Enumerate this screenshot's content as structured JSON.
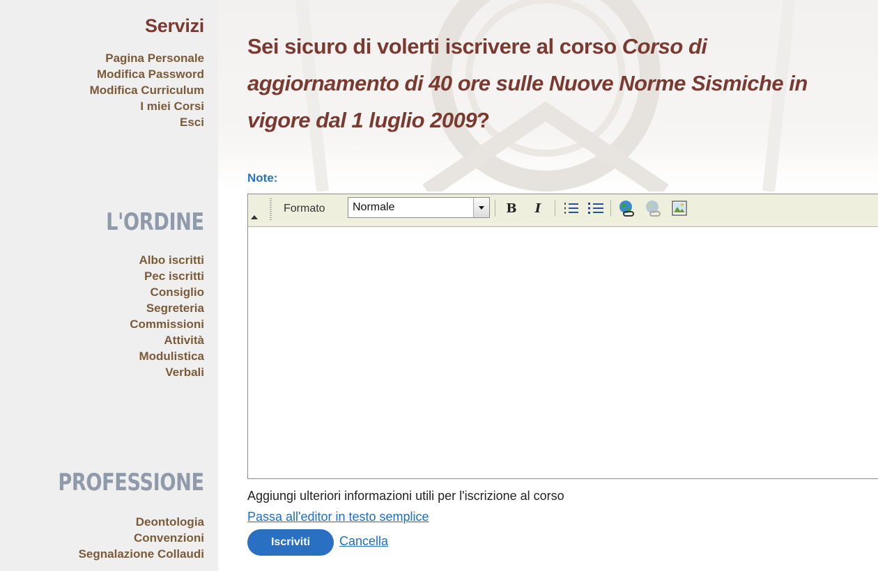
{
  "sidebar": {
    "servizi": {
      "title": "Servizi",
      "items": [
        "Pagina Personale",
        "Modifica Password",
        "Modifica Curriculum",
        "I miei Corsi",
        "Esci"
      ]
    },
    "ordine": {
      "title": "L'ORDINE",
      "items": [
        "Albo iscritti",
        "Pec iscritti",
        "Consiglio",
        "Segreteria",
        "Commissioni",
        "Attività",
        "Modulistica",
        "Verbali"
      ]
    },
    "professione": {
      "title": "PROFESSIONE",
      "items": [
        "Deontologia",
        "Convenzioni",
        "Segnalazione Collaudi"
      ]
    }
  },
  "main": {
    "title_prefix": "Sei sicuro di volerti iscrivere al corso ",
    "course_name": "Corso di aggiornamento di 40 ore sulle Nuove Norme Sismiche in vigore dal 1 luglio 2009",
    "title_suffix": "?",
    "note_label": "Note:",
    "editor": {
      "format_label": "Formato",
      "format_value": "Normale",
      "content": "",
      "toolbar_icons": [
        "bold-icon",
        "italic-icon",
        "ordered-list-icon",
        "unordered-list-icon",
        "insert-link-icon",
        "remove-link-icon",
        "insert-image-icon"
      ]
    },
    "help_text": "Aggiungi ulteriori informazioni utili per l'iscrizione al corso",
    "plain_editor_link": "Passa all'editor in testo semplice",
    "submit_label": "Iscriviti",
    "cancel_label": "Cancella"
  },
  "colors": {
    "sidebar_bg": "#efefef",
    "title_color": "#7a3a30",
    "section_grey": "#8f9aaa",
    "menu_link": "#7b5a38",
    "accent_blue": "#2970c3",
    "toolbar_bg": "#efefde"
  }
}
